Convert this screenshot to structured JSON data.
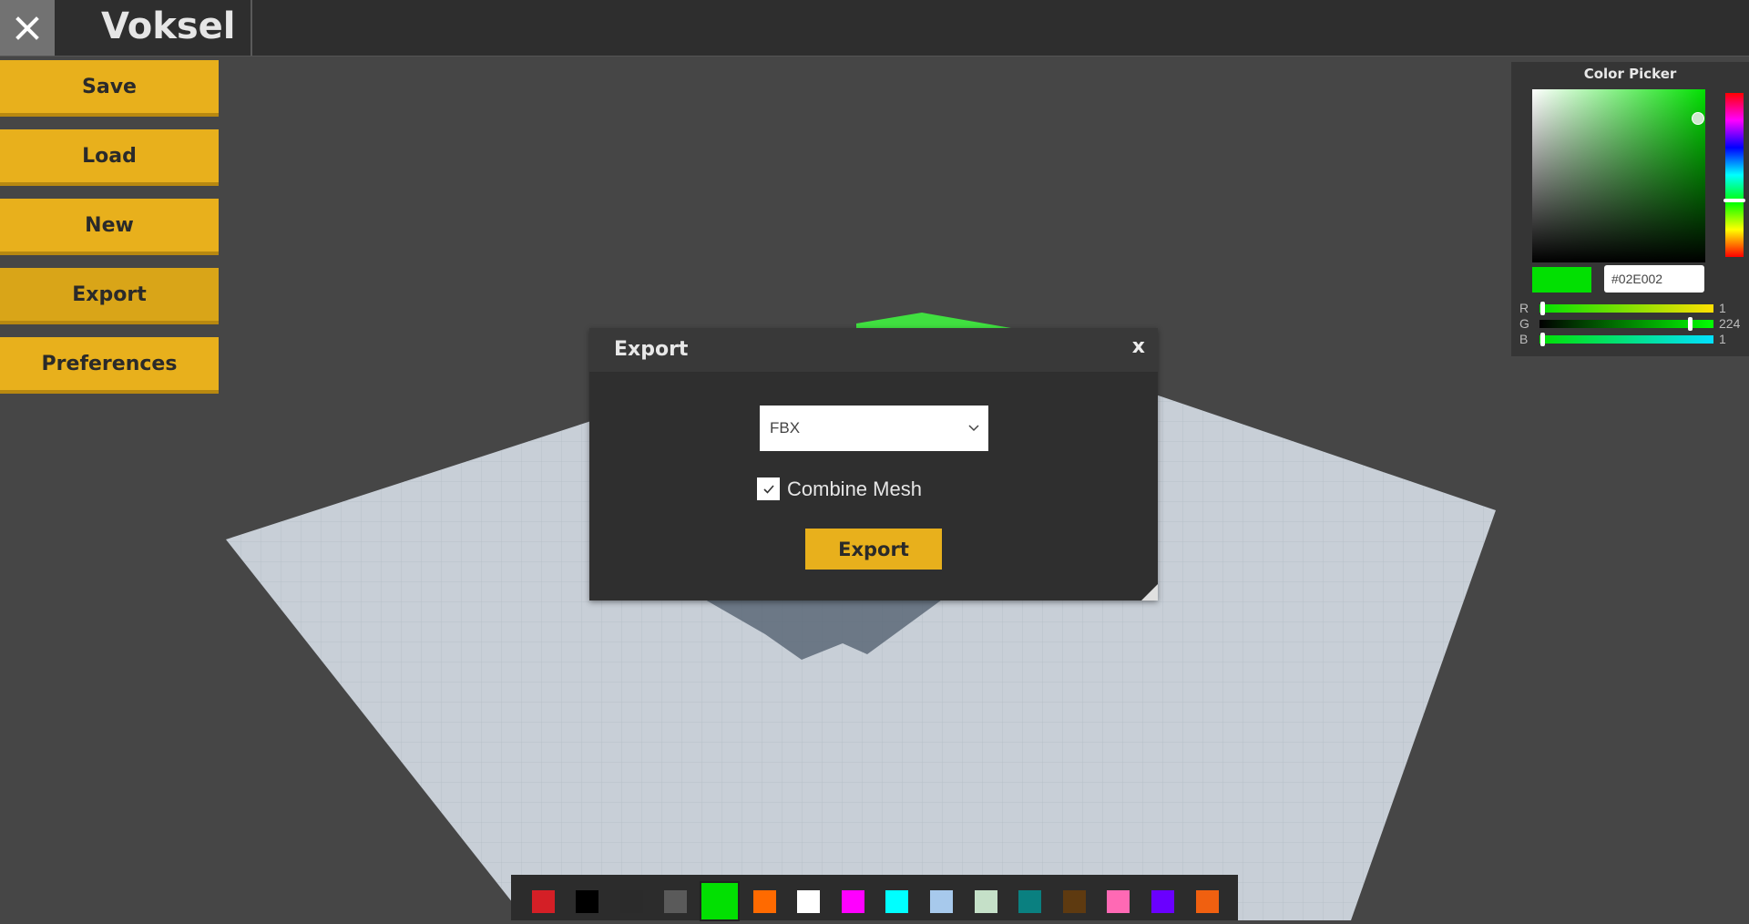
{
  "app": {
    "title": "Voksel"
  },
  "menu": [
    {
      "id": "save",
      "label": "Save"
    },
    {
      "id": "load",
      "label": "Load"
    },
    {
      "id": "new",
      "label": "New"
    },
    {
      "id": "export",
      "label": "Export",
      "active": true
    },
    {
      "id": "preferences",
      "label": "Preferences"
    }
  ],
  "color_picker": {
    "title": "Color Picker",
    "hex": "#02E002",
    "current_color": "#02E002",
    "channels": [
      {
        "label": "R",
        "value": "1",
        "level": 0.004
      },
      {
        "label": "G",
        "value": "224",
        "level": 0.878
      },
      {
        "label": "B",
        "value": "1",
        "level": 0.004
      }
    ]
  },
  "export_dialog": {
    "title": "Export",
    "close_label": "x",
    "format": {
      "selected": "FBX"
    },
    "combine_mesh": {
      "label": "Combine Mesh",
      "checked": true
    },
    "export_button": "Export"
  },
  "palette": {
    "colors": [
      "#d41f26",
      "#000000",
      "#2b2b2b",
      "#5a5a5a",
      "#02e002",
      "#ff6a00",
      "#ffffff",
      "#ff00ff",
      "#00ffff",
      "#a7c9ec",
      "#c5e0c8",
      "#0a8080",
      "#5e3a10",
      "#ff69b4",
      "#6a00ff",
      "#f06010"
    ],
    "selected_index": 4
  },
  "accent_color": "#e8b01c"
}
